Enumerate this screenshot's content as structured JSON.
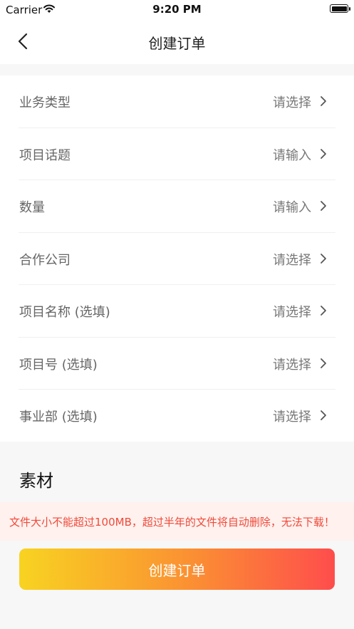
{
  "status_bar": {
    "carrier": "Carrier",
    "time": "9:20 PM"
  },
  "nav": {
    "title": "创建订单"
  },
  "form": {
    "rows": [
      {
        "label": "业务类型",
        "value": "请选择"
      },
      {
        "label": "项目话题",
        "value": "请输入"
      },
      {
        "label": "数量",
        "value": "请输入"
      },
      {
        "label": "合作公司",
        "value": "请选择"
      },
      {
        "label": "项目名称 (选填)",
        "value": "请选择"
      },
      {
        "label": "项目号 (选填)",
        "value": "请选择"
      },
      {
        "label": "事业部 (选填)",
        "value": "请选择"
      }
    ]
  },
  "materials": {
    "title": "素材",
    "warning": "文件大小不能超过100MB，超过半年的文件将自动删除，无法下载！"
  },
  "actions": {
    "create_label": "创建订单"
  },
  "colors": {
    "warning_text": "#ef4a3a",
    "warning_bg": "#fff1ee",
    "button_gradient_start": "#f8d321",
    "button_gradient_end": "#fe4d4c"
  },
  "icons": {
    "wifi": "wifi-icon",
    "battery": "battery-icon",
    "back": "chevron-left-icon",
    "row_arrow": "chevron-right-icon"
  }
}
